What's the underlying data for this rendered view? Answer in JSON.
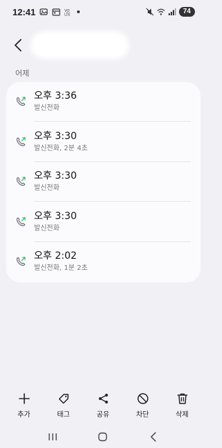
{
  "status_bar": {
    "time": "12:41",
    "battery": "74",
    "left_icons": [
      "gallery-icon",
      "calendar-icon",
      "dual-sim-icon",
      "dot-icon"
    ],
    "right_icons": [
      "mute-icon",
      "wifi-icon",
      "signal-icon"
    ]
  },
  "header": {
    "back_icon": "chevron-left-icon",
    "contact_name": ""
  },
  "section": {
    "label": "어제"
  },
  "calls": [
    {
      "time": "오후 3:36",
      "detail": "발신전화",
      "type": "outgoing"
    },
    {
      "time": "오후 3:30",
      "detail": "발신전화, 2분 4초",
      "type": "outgoing"
    },
    {
      "time": "오후 3:30",
      "detail": "발신전화",
      "type": "outgoing"
    },
    {
      "time": "오후 3:30",
      "detail": "발신전화",
      "type": "outgoing"
    },
    {
      "time": "오후 2:02",
      "detail": "발신전화, 1분 2초",
      "type": "outgoing"
    }
  ],
  "colors": {
    "outgoing_arrow": "#3ebc6a",
    "phone_icon": "#6b7280",
    "background": "#f1f1f5",
    "card": "#fbfbfd"
  },
  "actions": [
    {
      "label": "추가",
      "icon": "plus-icon"
    },
    {
      "label": "태그",
      "icon": "tag-icon"
    },
    {
      "label": "공유",
      "icon": "share-icon"
    },
    {
      "label": "차단",
      "icon": "block-icon"
    },
    {
      "label": "삭제",
      "icon": "trash-icon"
    }
  ],
  "nav": {
    "recents_icon": "recents-icon",
    "home_icon": "home-icon",
    "back_icon": "nav-back-icon"
  }
}
